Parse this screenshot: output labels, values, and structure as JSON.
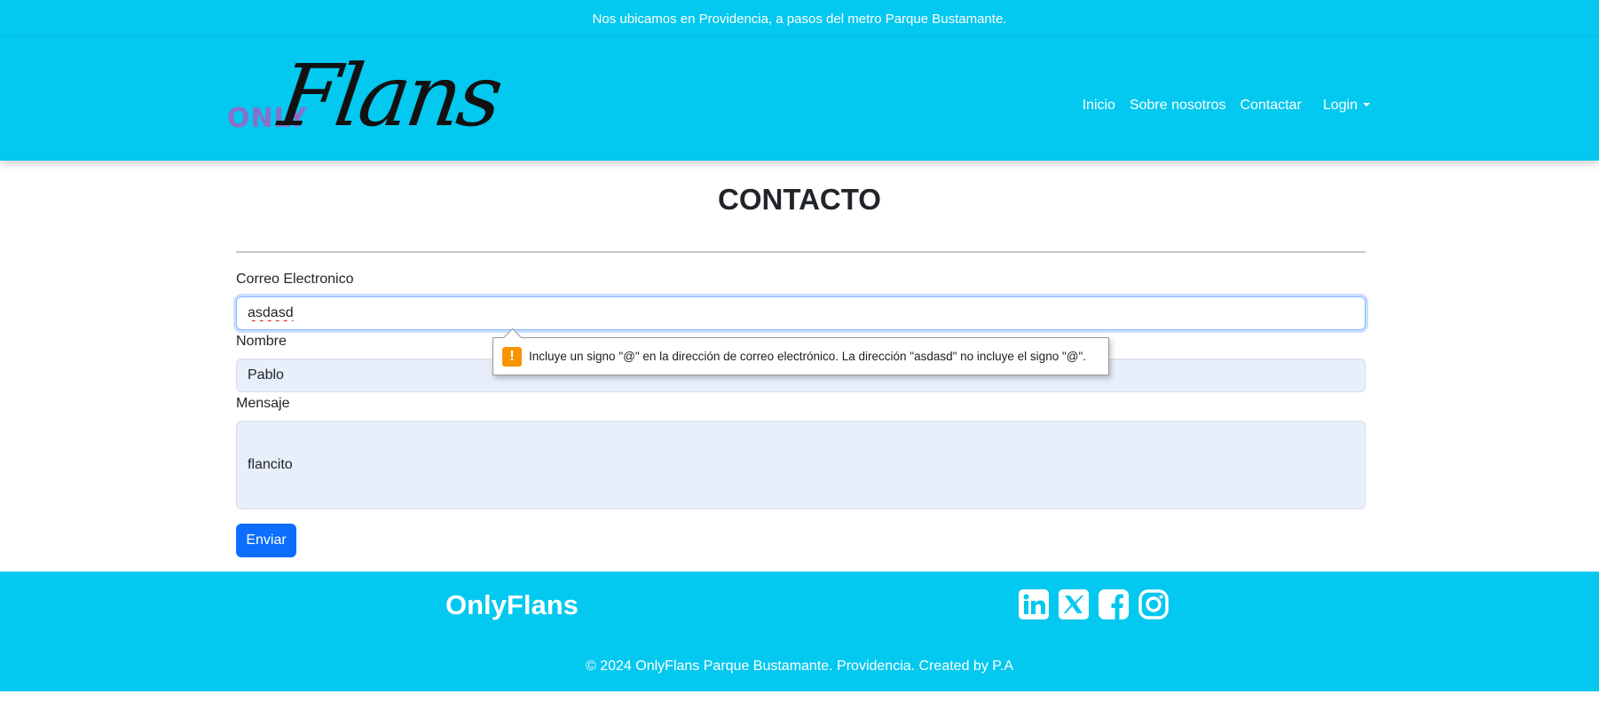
{
  "topbar": {
    "announcement": "Nos ubicamos en Providencia, a pasos del metro Parque Bustamante."
  },
  "brand": {
    "logo_prefix": "ONLY",
    "logo_main": "Flans"
  },
  "nav": {
    "links": [
      "Inicio",
      "Sobre nosotros",
      "Contactar"
    ],
    "dropdown_label": "Login"
  },
  "page": {
    "title": "CONTACTO"
  },
  "form": {
    "email_label": "Correo Electronico",
    "email_value": "asdasd",
    "name_label": "Nombre",
    "name_value": "Pablo",
    "message_label": "Mensaje",
    "message_value": "flancito",
    "submit_label": "Enviar"
  },
  "validation": {
    "icon": "warning-icon",
    "message": "Incluye un signo \"@\" en la dirección de correo electrónico. La dirección \"asdasd\" no incluye el signo \"@\"."
  },
  "footer": {
    "brand": "OnlyFlans",
    "social_icons": [
      "linkedin-icon",
      "x-twitter-icon",
      "facebook-icon",
      "instagram-icon"
    ],
    "copyright": "© 2024 OnlyFlans Parque Bustamante. Providencia. Created by P.A"
  },
  "colors": {
    "brand_cyan": "#03c8ef",
    "primary_button": "#0d6efd",
    "warning": "#f79500",
    "logo_purple": "#8a6fc9"
  }
}
